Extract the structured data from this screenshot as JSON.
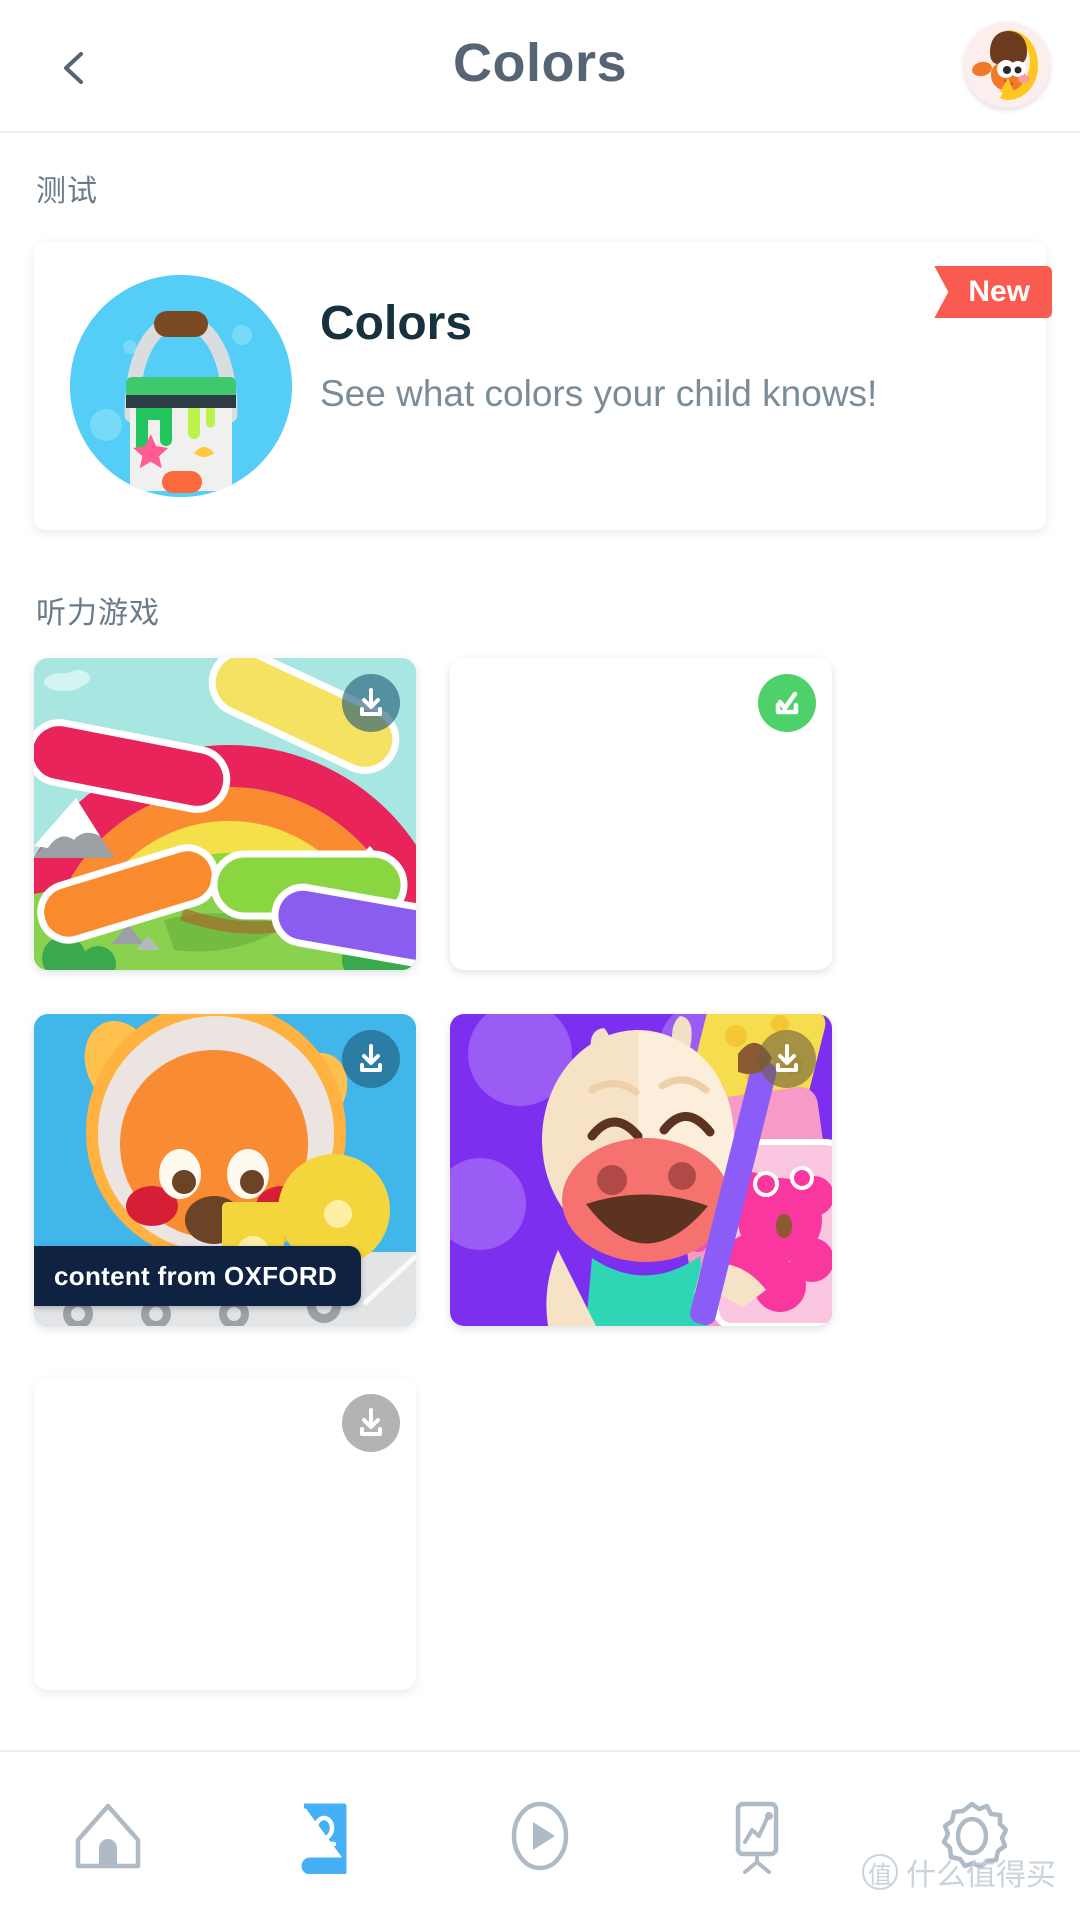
{
  "header": {
    "title": "Colors",
    "back_icon": "chevron-left-icon",
    "avatar_icon": "dog-avatar-icon"
  },
  "sections": [
    {
      "id": "test",
      "label": "测试"
    },
    {
      "id": "listening",
      "label": "听力游戏"
    }
  ],
  "featured": {
    "title": "Colors",
    "description": "See what colors your child knows!",
    "badge": "New",
    "badge_color": "#fa5b51",
    "icon": "paint-bucket-icon",
    "icon_bg": "#54cdf7"
  },
  "games": [
    {
      "id": "rainbow",
      "artwork": "rainbow-puzzle-art",
      "badge": "download-icon",
      "badge_state": "not-downloaded",
      "badge_color": "#1e5a78"
    },
    {
      "id": "blank",
      "artwork": "blank-art",
      "badge": "downloaded-check-icon",
      "badge_state": "downloaded",
      "badge_color": "#4ed16a"
    },
    {
      "id": "oxford",
      "artwork": "bear-conveyor-art",
      "badge": "download-icon",
      "badge_state": "not-downloaded",
      "badge_color": "#1e5a78",
      "tag": "content from OXFORD"
    },
    {
      "id": "cow",
      "artwork": "cow-painting-art",
      "badge": "download-icon",
      "badge_state": "not-downloaded",
      "badge_color": "#8a7a5a"
    },
    {
      "id": "partial",
      "artwork": "blank-art",
      "badge": "download-icon",
      "badge_state": "not-downloaded",
      "badge_color": "#b3b3b3"
    }
  ],
  "bottom_nav": {
    "active_index": 1,
    "active_color": "#45b0f5",
    "inactive_color": "#aebbc6",
    "items": [
      {
        "id": "home",
        "icon": "home-icon",
        "active": false
      },
      {
        "id": "library",
        "icon": "book-icon",
        "active": true
      },
      {
        "id": "play",
        "icon": "play-icon",
        "active": false
      },
      {
        "id": "progress",
        "icon": "easel-chart-icon",
        "active": false
      },
      {
        "id": "settings",
        "icon": "gear-icon",
        "active": false
      }
    ]
  },
  "watermark": {
    "mark": "值",
    "text": "什么值得买"
  }
}
